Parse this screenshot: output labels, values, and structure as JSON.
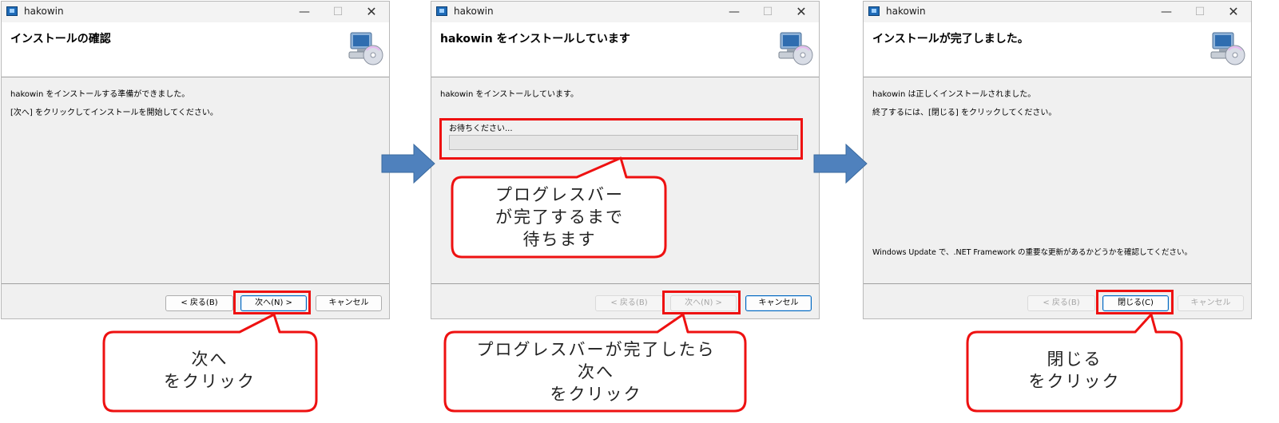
{
  "windows": [
    {
      "title": "hakowin",
      "header_title": "インストールの確認",
      "body_lines": [
        "hakowin をインストールする準備ができました。",
        "[次へ] をクリックしてインストールを開始してください。"
      ],
      "buttons": [
        "< 戻る(B)",
        "次へ(N) >",
        "キャンセル"
      ]
    },
    {
      "title": "hakowin",
      "header_title": "hakowin をインストールしています",
      "body_lines": [
        "hakowin をインストールしています。"
      ],
      "progress_label": "お待ちください...",
      "progress_value": 0,
      "buttons": [
        "< 戻る(B)",
        "次へ(N) >",
        "キャンセル"
      ]
    },
    {
      "title": "hakowin",
      "header_title": "インストールが完了しました。",
      "body_lines": [
        "hakowin は正しくインストールされました。",
        "終了するには、[閉じる] をクリックしてください。"
      ],
      "note": "Windows Update で、.NET Framework の重要な更新があるかどうかを確認してください。",
      "buttons": [
        "< 戻る(B)",
        "閉じる(C)",
        "キャンセル"
      ]
    }
  ],
  "callouts": [
    "次へ\nをクリック",
    "プログレスバー\nが完了するまで\n待ちます",
    "プログレスバーが完了したら\n次へ\nをクリック",
    "閉じる\nをクリック"
  ],
  "colors": {
    "highlight": "#ee1111",
    "arrow": "#4f81bd",
    "dialog_bg": "#f0f0f0"
  }
}
